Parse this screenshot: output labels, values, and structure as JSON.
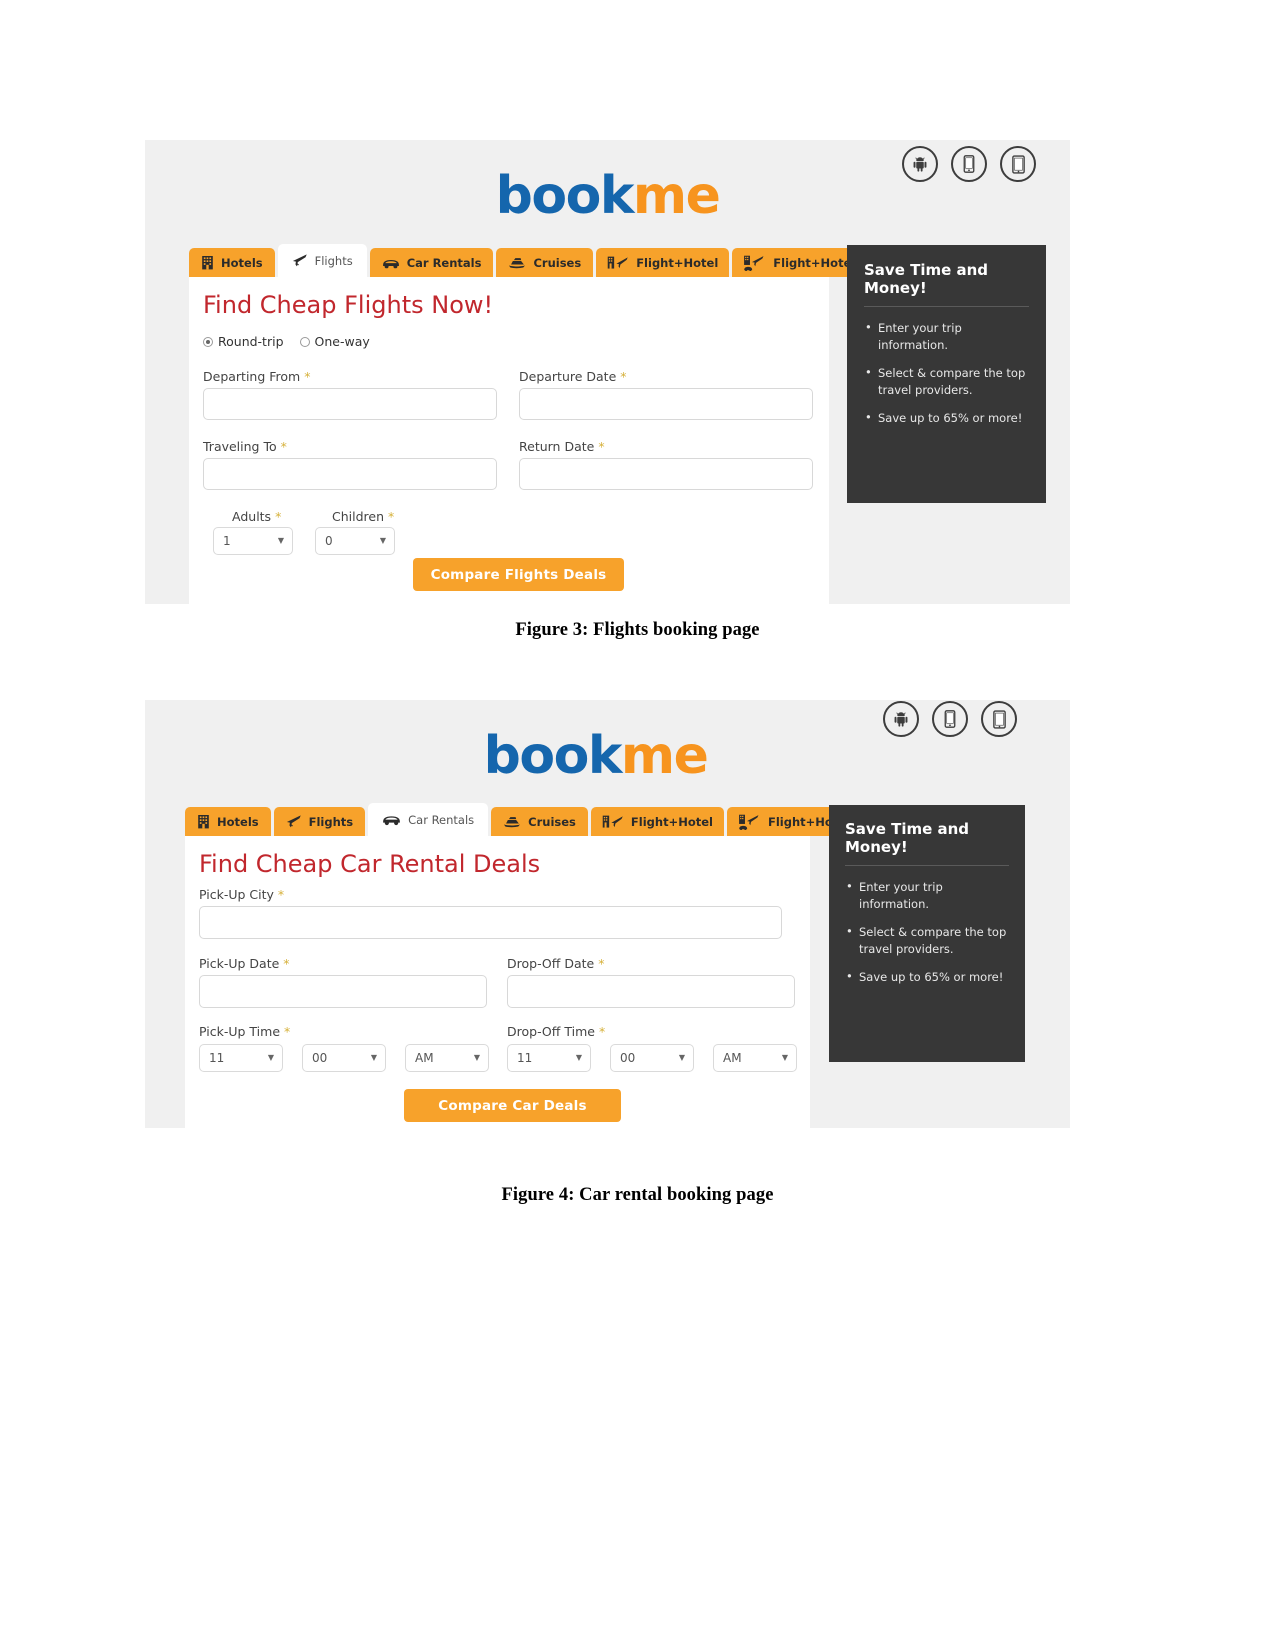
{
  "document": {
    "caption_3": "Figure 3: Flights booking page",
    "caption_4": "Figure 4: Car rental booking page"
  },
  "brand": {
    "name_part1": "book",
    "name_part2": "me",
    "color_primary": "#1566ad",
    "color_accent": "#f7941e"
  },
  "store_badges": [
    {
      "name": "android-badge",
      "label": "Android"
    },
    {
      "name": "iphone-badge",
      "label": "iPhone"
    },
    {
      "name": "tablet-badge",
      "label": "Tablet"
    }
  ],
  "tabs": [
    {
      "label": "Hotels",
      "icon": "hotel-icon"
    },
    {
      "label": "Flights",
      "icon": "plane-icon"
    },
    {
      "label": "Car Rentals",
      "icon": "car-icon"
    },
    {
      "label": "Cruises",
      "icon": "ship-icon"
    },
    {
      "label": "Flight+Hotel",
      "icon": "flight-hotel-icon"
    },
    {
      "label": "Flight+Hotel+Car",
      "icon": "flight-hotel-car-icon"
    }
  ],
  "promo": {
    "heading": "Save Time and Money!",
    "bullets": [
      "Enter your trip information.",
      "Select & compare the top travel providers.",
      "Save up to 65% or more!"
    ]
  },
  "flights": {
    "title": "Find Cheap Flights Now!",
    "active_tab": "Flights",
    "trip_type": {
      "round_trip_label": "Round-trip",
      "one_way_label": "One-way",
      "selected": "Round-trip"
    },
    "fields": {
      "departing_from": {
        "label": "Departing From",
        "required": "*",
        "value": "",
        "placeholder": ""
      },
      "departure_date": {
        "label": "Departure Date",
        "required": "*",
        "value": "",
        "placeholder": ""
      },
      "traveling_to": {
        "label": "Traveling To",
        "required": "*",
        "value": "",
        "placeholder": ""
      },
      "return_date": {
        "label": "Return Date",
        "required": "*",
        "value": "",
        "placeholder": ""
      },
      "adults": {
        "label": "Adults",
        "required": "*",
        "value": "1"
      },
      "children": {
        "label": "Children",
        "required": "*",
        "value": "0"
      }
    },
    "submit_label": "Compare Flights Deals"
  },
  "cars": {
    "title": "Find Cheap Car Rental Deals",
    "active_tab": "Car Rentals",
    "fields": {
      "pickup_city": {
        "label": "Pick-Up City",
        "required": "*",
        "value": "",
        "placeholder": ""
      },
      "pickup_date": {
        "label": "Pick-Up Date",
        "required": "*",
        "value": "",
        "placeholder": ""
      },
      "dropoff_date": {
        "label": "Drop-Off Date",
        "required": "*",
        "value": "",
        "placeholder": ""
      },
      "pickup_time": {
        "label": "Pick-Up Time",
        "required": "*",
        "hour": "11",
        "minute": "00",
        "meridiem": "AM"
      },
      "dropoff_time": {
        "label": "Drop-Off Time",
        "required": "*",
        "hour": "11",
        "minute": "00",
        "meridiem": "AM"
      }
    },
    "submit_label": "Compare Car Deals"
  }
}
